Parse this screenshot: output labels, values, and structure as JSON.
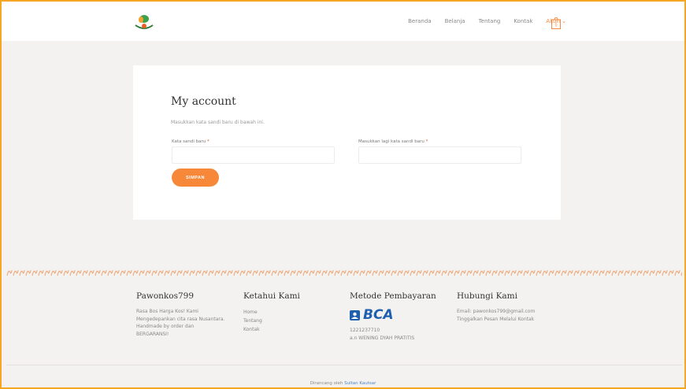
{
  "nav": {
    "items": [
      "Beranda",
      "Belanja",
      "Tentang",
      "Kontak",
      "Akun ⌄"
    ],
    "active_index": 4,
    "cart_count": "0"
  },
  "account": {
    "title": "My account",
    "subtitle": "Masukkan kata sandi baru di bawah ini.",
    "new_password_label": "Kata sandi baru",
    "confirm_password_label": "Masukkan lagi kata sandi baru",
    "required_mark": "*",
    "new_password_value": "",
    "confirm_password_value": "",
    "save_label": "SIMPAN"
  },
  "footer": {
    "col1": {
      "heading": "Pawonkos799",
      "text": "Rasa Bos Harga Kos! Kami Mengedepankan cita rasa Nusantara. Handmade by order dan BERGARANSI!"
    },
    "col2": {
      "heading": "Ketahui Kami",
      "links": [
        "Home",
        "Tentang",
        "Kontak"
      ]
    },
    "col3": {
      "heading": "Metode Pembayaran",
      "bank": "BCA",
      "account_number": "1221237710",
      "account_name": "a.n WENING DYAH PRATITIS"
    },
    "col4": {
      "heading": "Hubungi Kami",
      "email": "Email: pawonkos799@gmail.com",
      "contact_link": "Tinggalkan Pesan Melalui Kontak"
    },
    "credit_prefix": "Dirancang oleh ",
    "credit_name": "Sultan Kautsar"
  },
  "colors": {
    "accent": "#f7883a",
    "frame": "#f5a623",
    "bca_blue": "#1f5fb0"
  }
}
